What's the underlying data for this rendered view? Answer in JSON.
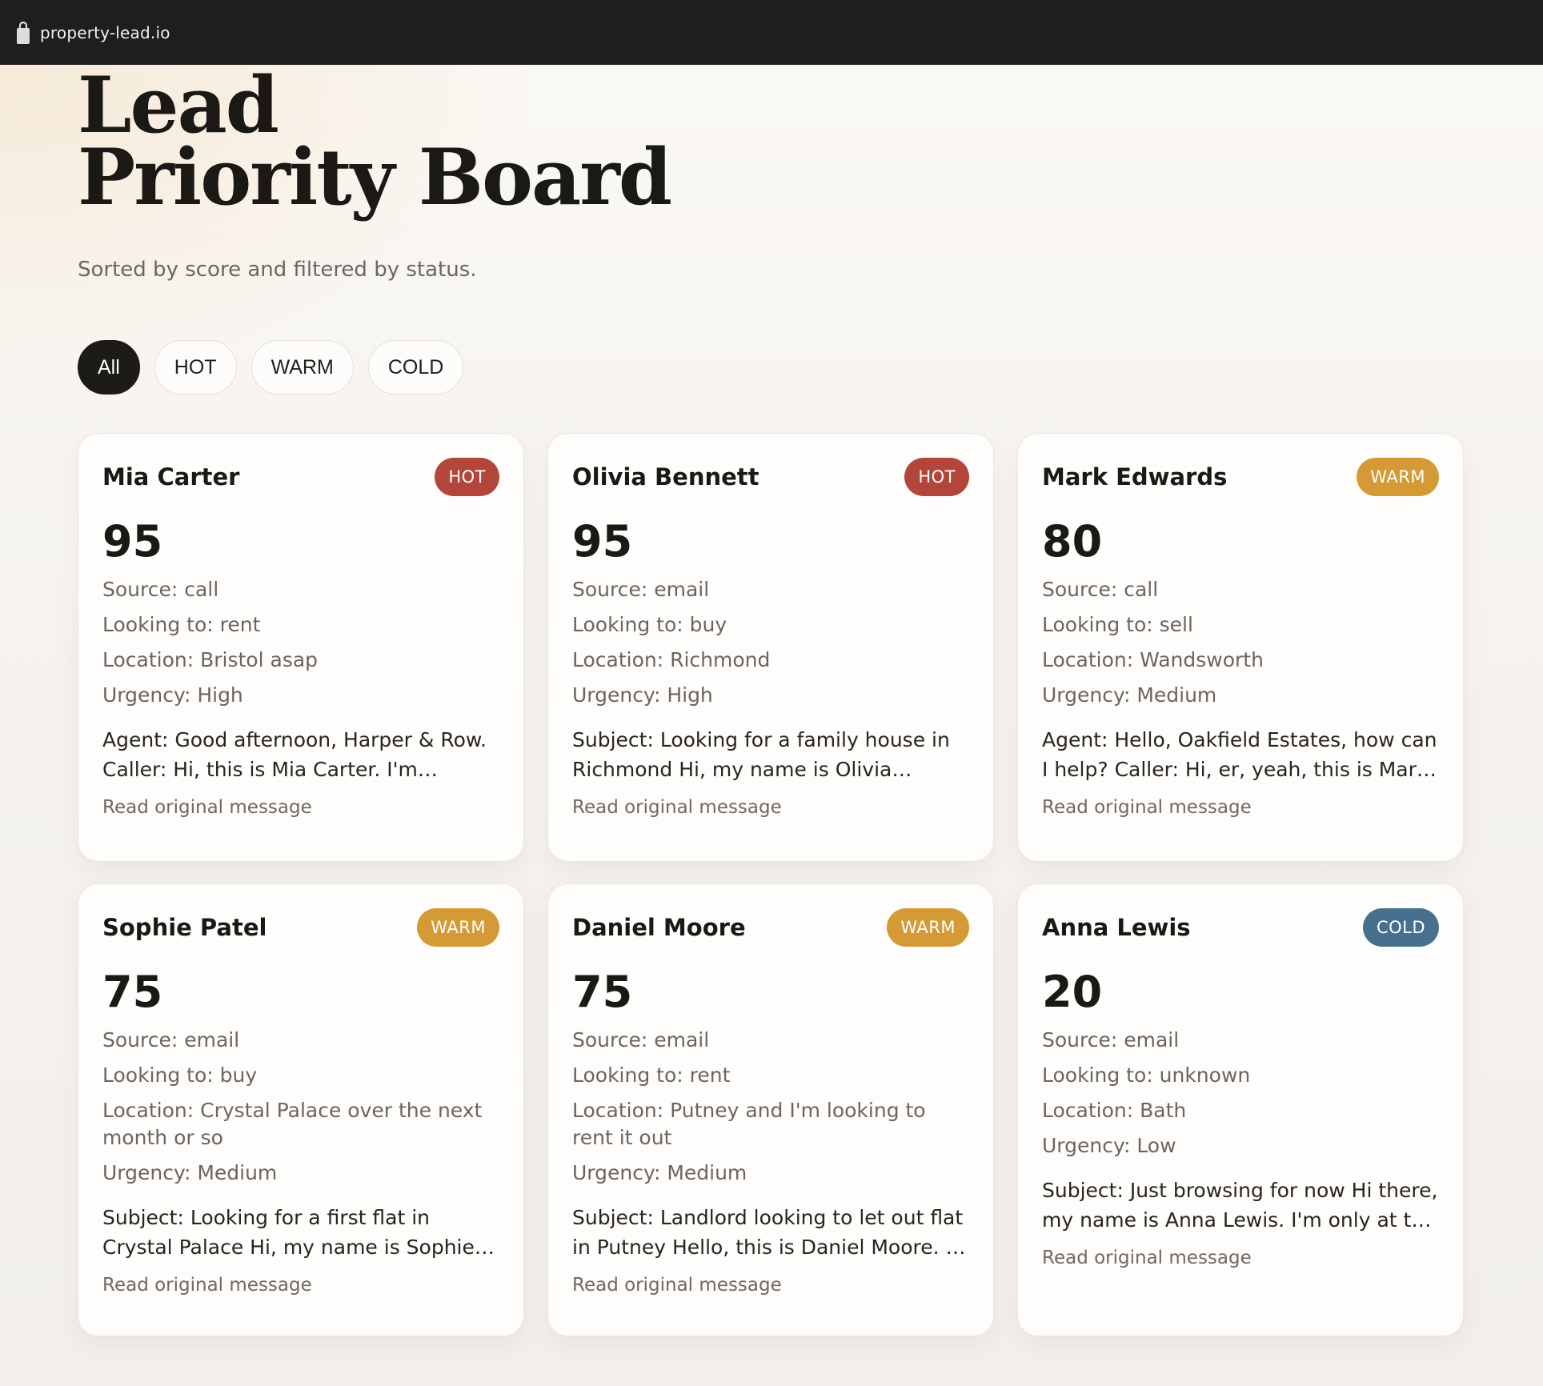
{
  "browser": {
    "url": "property-lead.io"
  },
  "header": {
    "title_line1": "Lead",
    "title_line2": "Priority Board",
    "subtitle": "Sorted by score and filtered by status."
  },
  "filters": [
    {
      "label": "All",
      "active": true
    },
    {
      "label": "HOT",
      "active": false
    },
    {
      "label": "WARM",
      "active": false
    },
    {
      "label": "COLD",
      "active": false
    }
  ],
  "status_colors": {
    "HOT": "#b2463a",
    "WARM": "#d39a35",
    "COLD": "#46708e"
  },
  "read_link_label": "Read original message",
  "leads": [
    {
      "name": "Mia Carter",
      "status": "HOT",
      "score": "95",
      "source": "Source: call",
      "looking": "Looking to: rent",
      "location": "Location: Bristol asap",
      "urgency": "Urgency: High",
      "message": "Agent: Good afternoon, Harper & Row. Caller: Hi, this is Mia Carter. I'm relocating to Bristol asap"
    },
    {
      "name": "Olivia Bennett",
      "status": "HOT",
      "score": "95",
      "source": "Source: email",
      "looking": "Looking to: buy",
      "location": "Location: Richmond",
      "urgency": "Urgency: High",
      "message": "Subject: Looking for a family house in Richmond Hi, my name is Olivia Bennett. We are looking"
    },
    {
      "name": "Mark Edwards",
      "status": "WARM",
      "score": "80",
      "source": "Source: call",
      "looking": "Looking to: sell",
      "location": "Location: Wandsworth",
      "urgency": "Urgency: Medium",
      "message": "Agent: Hello, Oakfield Estates, how can I help? Caller: Hi, er, yeah, this is Mark Edwards"
    },
    {
      "name": "Sophie Patel",
      "status": "WARM",
      "score": "75",
      "source": "Source: email",
      "looking": "Looking to: buy",
      "location": "Location: Crystal Palace over the next month or so",
      "urgency": "Urgency: Medium",
      "message": "Subject: Looking for a first flat in Crystal Palace Hi, my name is Sophie Patel. I'm hoping to"
    },
    {
      "name": "Daniel Moore",
      "status": "WARM",
      "score": "75",
      "source": "Source: email",
      "looking": "Looking to: rent",
      "location": "Location: Putney and I'm looking to rent it out",
      "urgency": "Urgency: Medium",
      "message": "Subject: Landlord looking to let out flat in Putney Hello, this is Daniel Moore. I own a flat"
    },
    {
      "name": "Anna Lewis",
      "status": "COLD",
      "score": "20",
      "source": "Source: email",
      "looking": "Looking to: unknown",
      "location": "Location: Bath",
      "urgency": "Urgency: Low",
      "message": "Subject: Just browsing for now Hi there, my name is Anna Lewis. I'm only at the very start"
    }
  ]
}
